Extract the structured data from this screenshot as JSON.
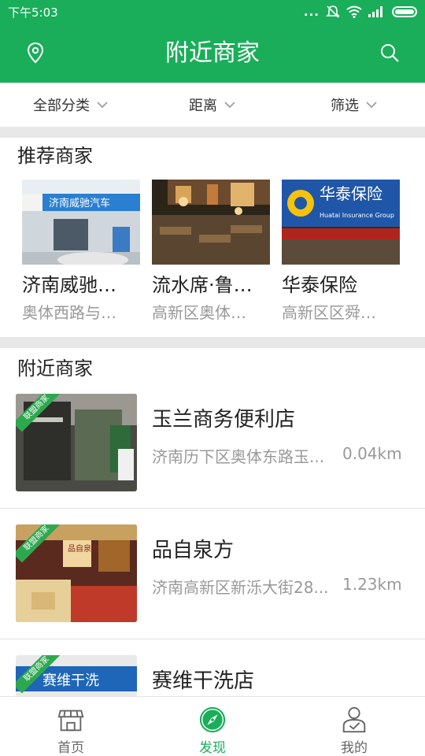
{
  "status_bar": {
    "time": "下午5:03",
    "dots": "..."
  },
  "app_bar": {
    "title": "附近商家"
  },
  "filters": [
    {
      "label": "全部分类"
    },
    {
      "label": "距离"
    },
    {
      "label": "筛选"
    }
  ],
  "recommended": {
    "title": "推荐商家",
    "items": [
      {
        "name": "济南威驰…",
        "address": "奥体西路与…",
        "sign_text": "济南威驰汽车"
      },
      {
        "name": "流水席·鲁…",
        "address": "高新区奥体…"
      },
      {
        "name": "华泰保险",
        "address": "高新区区舜…",
        "sign_text": "华泰保险",
        "sign_sub": "Huatai Insurance Group"
      }
    ]
  },
  "nearby": {
    "title": "附近商家",
    "badge": "联盟商家",
    "items": [
      {
        "name": "玉兰商务便利店",
        "address": "济南历下区奥体东路玉...",
        "distance": "0.04km"
      },
      {
        "name": "品自泉方",
        "address": "济南高新区新泺大街28...",
        "distance": "1.23km",
        "sign_text": "品自泉方"
      },
      {
        "name": "赛维干洗店",
        "address": "",
        "distance": "",
        "sign_text": "赛维干洗"
      }
    ]
  },
  "tab_bar": {
    "items": [
      {
        "label": "首页",
        "icon": "store-icon",
        "active": false
      },
      {
        "label": "发现",
        "icon": "compass-icon",
        "active": true
      },
      {
        "label": "我的",
        "icon": "profile-icon",
        "active": false
      }
    ]
  },
  "colors": {
    "brand": "#1aae5a",
    "divider": "#e8e8e8",
    "muted_text": "#999999"
  }
}
